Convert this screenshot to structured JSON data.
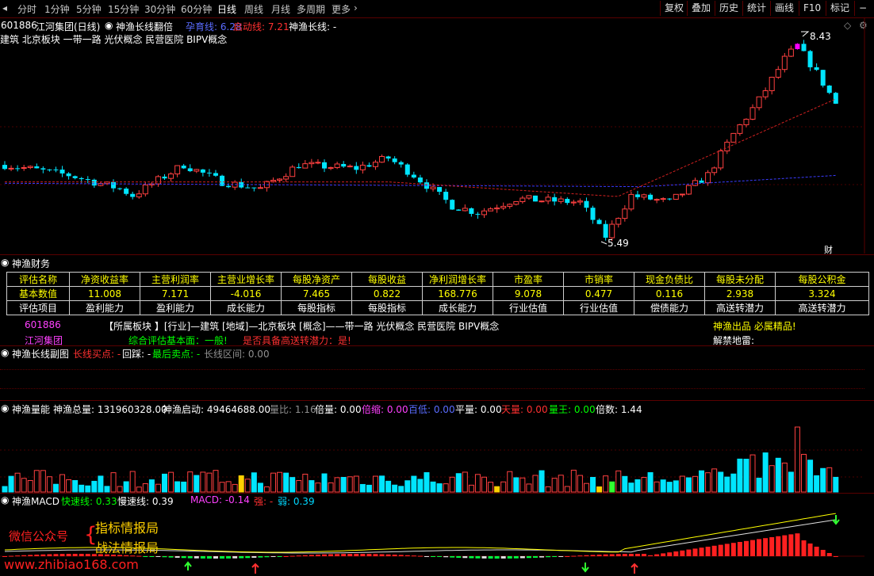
{
  "toolbar": {
    "periods": [
      "分时",
      "1分钟",
      "5分钟",
      "15分钟",
      "30分钟",
      "60分钟",
      "日线",
      "周线",
      "月线",
      "多周期",
      "更多"
    ],
    "active_period": "日线",
    "right_buttons": [
      "复权",
      "叠加",
      "历史",
      "统计",
      "画线",
      "F10",
      "标记",
      "−"
    ]
  },
  "main": {
    "code": "601886",
    "name": "江河集团(日线)",
    "indicator": "神渔长线翻倍",
    "line1_label": "孕育线: 6.28",
    "line2_label": "启动线: 7.21",
    "line3_label": "神渔长线: -",
    "sector_text": "建筑         北京板块    一带一路 光伏概念 民营医院 BIPV概念",
    "high_label": "8.43",
    "low_label": "5.49",
    "badge": "财",
    "colors": {
      "up": "#ff4040",
      "down": "#00e5ff",
      "magenta": "#ff00ff"
    }
  },
  "finance": {
    "title": "神渔财务",
    "headers": [
      "评估名称",
      "净资收益率",
      "主营利润率",
      "主营业增长率",
      "每股净资产",
      "每股收益",
      "净利润增长率",
      "市盈率",
      "市销率",
      "现金负债比",
      "每股未分配",
      "每股公积金"
    ],
    "values": [
      "基本数值",
      "11.008",
      "7.171",
      "-4.016",
      "7.465",
      "0.822",
      "168.776",
      "9.078",
      "0.477",
      "0.116",
      "2.938",
      "3.324"
    ],
    "items": [
      "评估项目",
      "盈利能力",
      "盈利能力",
      "成长能力",
      "每股指标",
      "每股指标",
      "成长能力",
      "行业估值",
      "行业估值",
      "偿债能力",
      "高送转潜力",
      "高送转潜力"
    ],
    "code": "601886",
    "name": "江河集团",
    "sector_line": "【所属板块 】[行业]—建筑 [地域]—北京板块 [概念]——带一路 光伏概念 民营医院 BIPV概念",
    "eval_line": "综合评估基本面：一般!",
    "transfer_line": "是否具备高送转潜力：是!",
    "slogan": "神渔出品 必属精品!",
    "unlock": "解禁地雷:"
  },
  "sub1": {
    "title": "神渔长线副图",
    "buy": "长线买点: -",
    "pullback": "回踩: -",
    "last_sell": "最后卖点: -",
    "range": "长线区间: 0.00"
  },
  "volume": {
    "title": "神渔量能",
    "total": "神渔总量: 131960328.00",
    "start": "神渔启动: 49464688.00",
    "ratio": "量比: 1.16",
    "times": "倍量: 0.00",
    "shrink": "倍缩: 0.00",
    "low": "百低: 0.00",
    "flat": "平量: 0.00",
    "sky": "天量: 0.00",
    "king": "量王: 0.00",
    "mult": "倍数: 1.44"
  },
  "macd": {
    "title": "神渔MACD",
    "fast": "快速线: 0.33",
    "slow": "慢速线: 0.39",
    "macd": "MACD: -0.14",
    "strong": "强: -",
    "weak": "弱: 0.39"
  },
  "watermark": {
    "left": "微信公众号",
    "line1": "指标情报局",
    "line2": "战法情报局",
    "url": "www.zhibiao168.com"
  }
}
